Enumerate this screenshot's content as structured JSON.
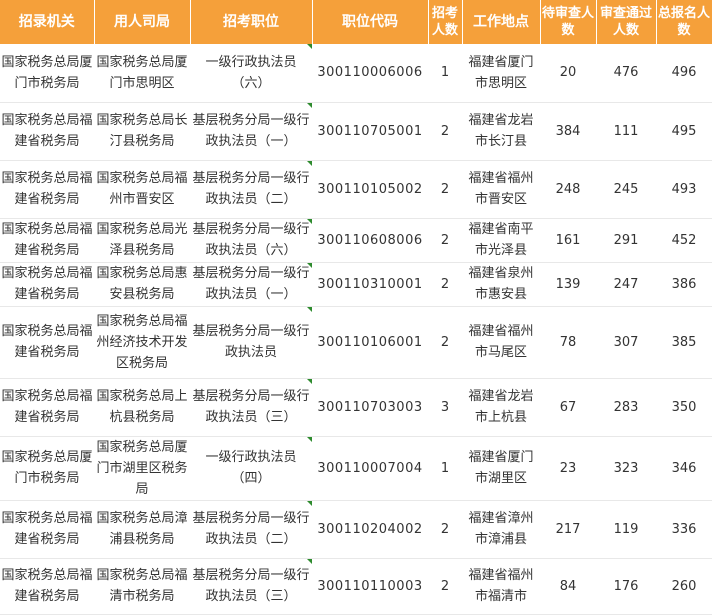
{
  "headers": {
    "agency": "招录机关",
    "employer": "用人司局",
    "position": "招考职位",
    "code": "职位代码",
    "quota": "招考人数",
    "location": "工作地点",
    "pending": "待审查人数",
    "passed": "审查通过人数",
    "total": "总报名人数"
  },
  "rows": [
    {
      "agency": "国家税务总局厦门市税务局",
      "employer": "国家税务总局厦门市思明区",
      "position": "一级行政执法员（六）",
      "code": "300110006006",
      "quota": "1",
      "location": "福建省厦门市思明区",
      "pending": "20",
      "passed": "476",
      "total": "496"
    },
    {
      "agency": "国家税务总局福建省税务局",
      "employer": "国家税务总局长汀县税务局",
      "position": "基层税务分局一级行政执法员（一）",
      "code": "300110705001",
      "quota": "2",
      "location": "福建省龙岩市长汀县",
      "pending": "384",
      "passed": "111",
      "total": "495"
    },
    {
      "agency": "国家税务总局福建省税务局",
      "employer": "国家税务总局福州市晋安区",
      "position": "基层税务分局一级行政执法员（二）",
      "code": "300110105002",
      "quota": "2",
      "location": "福建省福州市晋安区",
      "pending": "248",
      "passed": "245",
      "total": "493"
    },
    {
      "agency": "国家税务总局福建省税务局",
      "employer": "国家税务总局光泽县税务局",
      "position": "基层税务分局一级行政执法员（六）",
      "code": "300110608006",
      "quota": "2",
      "location": "福建省南平市光泽县",
      "pending": "161",
      "passed": "291",
      "total": "452"
    },
    {
      "agency": "国家税务总局福建省税务局",
      "employer": "国家税务总局惠安县税务局",
      "position": "基层税务分局一级行政执法员（一）",
      "code": "300110310001",
      "quota": "2",
      "location": "福建省泉州市惠安县",
      "pending": "139",
      "passed": "247",
      "total": "386"
    },
    {
      "agency": "国家税务总局福建省税务局",
      "employer": "国家税务总局福州经济技术开发区税务局",
      "position": "基层税务分局一级行政执法员",
      "code": "300110106001",
      "quota": "2",
      "location": "福建省福州市马尾区",
      "pending": "78",
      "passed": "307",
      "total": "385"
    },
    {
      "agency": "国家税务总局福建省税务局",
      "employer": "国家税务总局上杭县税务局",
      "position": "基层税务分局一级行政执法员（三）",
      "code": "300110703003",
      "quota": "3",
      "location": "福建省龙岩市上杭县",
      "pending": "67",
      "passed": "283",
      "total": "350"
    },
    {
      "agency": "国家税务总局厦门市税务局",
      "employer": "国家税务总局厦门市湖里区税务局",
      "position": "一级行政执法员（四）",
      "code": "300110007004",
      "quota": "1",
      "location": "福建省厦门市湖里区",
      "pending": "23",
      "passed": "323",
      "total": "346"
    },
    {
      "agency": "国家税务总局福建省税务局",
      "employer": "国家税务总局漳浦县税务局",
      "position": "基层税务分局一级行政执法员（二）",
      "code": "300110204002",
      "quota": "2",
      "location": "福建省漳州市漳浦县",
      "pending": "217",
      "passed": "119",
      "total": "336"
    },
    {
      "agency": "国家税务总局福建省税务局",
      "employer": "国家税务总局福清市税务局",
      "position": "基层税务分局一级行政执法员（三）",
      "code": "300110110003",
      "quota": "2",
      "location": "福建省福州市福清市",
      "pending": "84",
      "passed": "176",
      "total": "260"
    }
  ]
}
